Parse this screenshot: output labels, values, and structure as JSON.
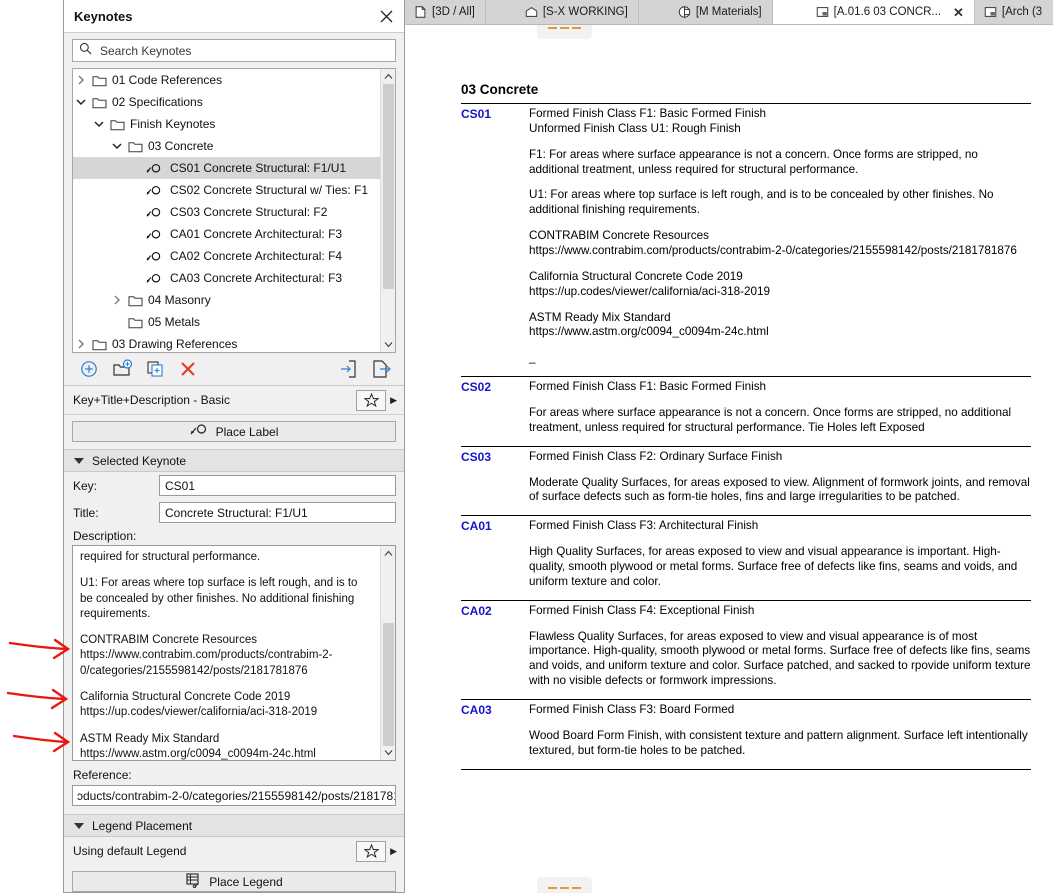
{
  "tabs": [
    {
      "label": "[3D / All]",
      "icon": "cube-icon",
      "active": false,
      "closable": false
    },
    {
      "label": "[S-X WORKING]",
      "icon": "elevation-icon",
      "active": false,
      "closable": false
    },
    {
      "label": "[M Materials]",
      "icon": "section-icon",
      "active": false,
      "closable": false
    },
    {
      "label": "[A.01.6 03 CONCR...",
      "icon": "layout-icon",
      "active": true,
      "closable": true
    },
    {
      "label": "[Arch (3",
      "icon": "layout-icon",
      "active": false,
      "closable": false
    }
  ],
  "palette": {
    "title": "Keynotes",
    "close_label": "×",
    "search": {
      "placeholder": "Search Keynotes",
      "value": ""
    },
    "tree": [
      {
        "label": "01 Code References",
        "type": "folder",
        "depth": 0,
        "twist": "collapsed",
        "selected": false
      },
      {
        "label": "02 Specifications",
        "type": "folder",
        "depth": 0,
        "twist": "expanded",
        "selected": false
      },
      {
        "label": "Finish Keynotes",
        "type": "folder",
        "depth": 1,
        "twist": "expanded",
        "selected": false
      },
      {
        "label": "03 Concrete",
        "type": "folder",
        "depth": 2,
        "twist": "expanded",
        "selected": false
      },
      {
        "label": "CS01 Concrete Structural: F1/U1",
        "type": "keynote",
        "depth": 3,
        "twist": "none",
        "selected": true
      },
      {
        "label": "CS02 Concrete Structural w/ Ties: F1",
        "type": "keynote",
        "depth": 3,
        "twist": "none",
        "selected": false
      },
      {
        "label": "CS03 Concrete Structural: F2",
        "type": "keynote",
        "depth": 3,
        "twist": "none",
        "selected": false
      },
      {
        "label": "CA01 Concrete Architectural: F3",
        "type": "keynote",
        "depth": 3,
        "twist": "none",
        "selected": false
      },
      {
        "label": "CA02 Concrete Architectural: F4",
        "type": "keynote",
        "depth": 3,
        "twist": "none",
        "selected": false
      },
      {
        "label": "CA03 Concrete Architectural: F3",
        "type": "keynote",
        "depth": 3,
        "twist": "none",
        "selected": false
      },
      {
        "label": "04 Masonry",
        "type": "folder",
        "depth": 2,
        "twist": "collapsed",
        "selected": false
      },
      {
        "label": "05 Metals",
        "type": "folder",
        "depth": 2,
        "twist": "none",
        "selected": false
      },
      {
        "label": "03 Drawing References",
        "type": "folder",
        "depth": 0,
        "twist": "collapsed",
        "selected": false
      }
    ],
    "toolbar": [
      {
        "name": "new-keynote-icon",
        "color": "#2b7fd4"
      },
      {
        "name": "new-folder-icon",
        "color": "#2b7fd4"
      },
      {
        "name": "duplicate-icon",
        "color": "#2b7fd4"
      },
      {
        "name": "delete-icon",
        "color": "#e33b21"
      },
      {
        "name": "import-icon",
        "color": "#2b7fd4"
      },
      {
        "name": "export-icon",
        "color": "#2b7fd4"
      }
    ],
    "label_style": "Key+Title+Description - Basic",
    "place_label_button": "Place Label",
    "selected_keynote_section": "Selected Keynote",
    "fields": {
      "key_label": "Key:",
      "key_value": "CS01",
      "title_label": "Title:",
      "title_value": "Concrete Structural: F1/U1",
      "description_label": "Description:",
      "description_paragraphs": [
        "required for structural performance.",
        "U1: For areas where top surface is left rough, and is to be concealed by other finishes. No additional finishing requirements.",
        "CONTRABIM Concrete Resources\nhttps://www.contrabim.com/products/contrabim-2-0/categories/2155598142/posts/2181781876",
        "California Structural Concrete Code 2019\nhttps://up.codes/viewer/california/aci-318-2019",
        "ASTM Ready Mix Standard\nhttps://www.astm.org/c0094_c0094m-24c.html",
        "_"
      ],
      "reference_label": "Reference:",
      "reference_value": "ɔducts/contrabim-2-0/categories/2155598142/posts/2181781876"
    },
    "legend_section": "Legend Placement",
    "legend_status": "Using default Legend",
    "place_legend_button": "Place Legend"
  },
  "document": {
    "title": "03 Concrete",
    "entries": [
      {
        "key": "CS01",
        "paragraphs": [
          "Formed Finish Class F1: Basic Formed Finish\nUnformed Finish Class U1: Rough Finish",
          "F1: For areas where surface appearance is not a concern. Once forms are stripped, no additional treatment, unless required for structural performance.",
          "U1: For areas where top surface is left rough, and is to be concealed by other finishes. No additional finishing requirements.",
          "CONTRABIM Concrete Resources\nhttps://www.contrabim.com/products/contrabim-2-0/categories/2155598142/posts/2181781876",
          "California Structural Concrete Code 2019\nhttps://up.codes/viewer/california/aci-318-2019",
          "ASTM Ready Mix Standard\nhttps://www.astm.org/c0094_c0094m-24c.html",
          "_"
        ]
      },
      {
        "key": "CS02",
        "paragraphs": [
          "Formed Finish Class F1: Basic Formed Finish",
          "For areas where surface appearance is not a concern. Once forms are stripped, no additional treatment, unless required for structural performance. Tie Holes left Exposed"
        ]
      },
      {
        "key": "CS03",
        "paragraphs": [
          "Formed Finish Class F2: Ordinary Surface Finish",
          "Moderate Quality Surfaces, for areas exposed to view. Alignment of formwork joints, and removal of surface defects such as form-tie holes, fins and large irregularities to be patched."
        ]
      },
      {
        "key": "CA01",
        "paragraphs": [
          "Formed Finish Class F3: Architectural Finish",
          "High Quality Surfaces, for areas exposed to view and visual appearance is important. High-quality, smooth plywood or metal forms. Surface free of defects like fins, seams and voids, and uniform texture and color."
        ]
      },
      {
        "key": "CA02",
        "paragraphs": [
          "Formed Finish Class F4: Exceptional Finish",
          "Flawless Quality Surfaces, for areas exposed to view and visual appearance is of most importance. High-quality, smooth plywood or metal forms. Surface free of defects like fins, seams and voids, and uniform texture and color. Surface patched, and sacked to rpovide uniform texture with no visible defects or formwork impressions."
        ]
      },
      {
        "key": "CA03",
        "paragraphs": [
          "Formed Finish Class F3: Board Formed",
          "Wood Board Form Finish, with consistent texture and pattern alignment. Surface left intentionally textured, but form-tie holes to be patched."
        ]
      }
    ]
  },
  "annotations": {
    "arrow_color": "#e8170f",
    "arrow_count": 3,
    "targets": [
      "contrabim-url",
      "upcodes-url",
      "astm-url"
    ]
  },
  "colors": {
    "key_blue": "#1414cc",
    "accent_blue": "#2b7fd4",
    "delete_red": "#e33b21",
    "pagebreak_orange": "#e8963c",
    "selection_gray": "#d6d6d6"
  }
}
